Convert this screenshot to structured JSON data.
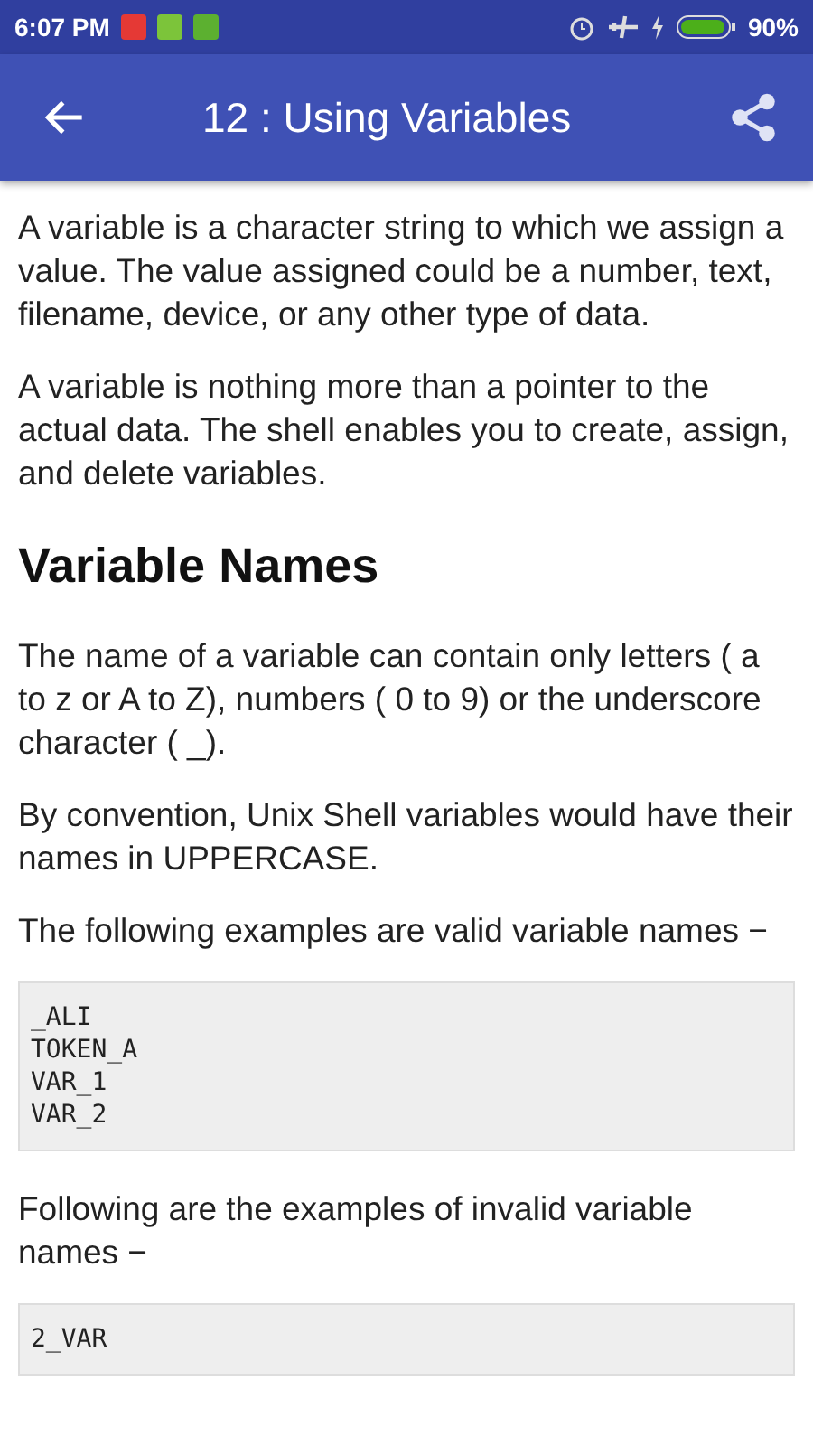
{
  "status_bar": {
    "time": "6:07 PM",
    "battery_percent": "90%"
  },
  "app_bar": {
    "title": "12 : Using Variables"
  },
  "content": [
    {
      "kind": "paragraph",
      "text": "A variable is a character string to which we assign a value. The value assigned could be a number, text, filename, device, or any other type of data."
    },
    {
      "kind": "paragraph",
      "text": "A variable is nothing more than a pointer to the actual data. The shell enables you to create, assign, and delete variables."
    },
    {
      "kind": "heading",
      "text": "Variable Names"
    },
    {
      "kind": "paragraph",
      "text": "The name of a variable can contain only letters ( a to z or A to Z), numbers ( 0 to 9) or the underscore character ( _)."
    },
    {
      "kind": "paragraph",
      "text": "By convention, Unix Shell variables would have their names in UPPERCASE."
    },
    {
      "kind": "paragraph",
      "text": "The following examples are valid variable names −"
    },
    {
      "kind": "code",
      "lines": [
        "_ALI",
        "TOKEN_A",
        "VAR_1",
        "VAR_2"
      ]
    },
    {
      "kind": "paragraph",
      "text": "Following are the examples of invalid variable names −"
    },
    {
      "kind": "code",
      "lines": [
        "2_VAR"
      ]
    }
  ]
}
